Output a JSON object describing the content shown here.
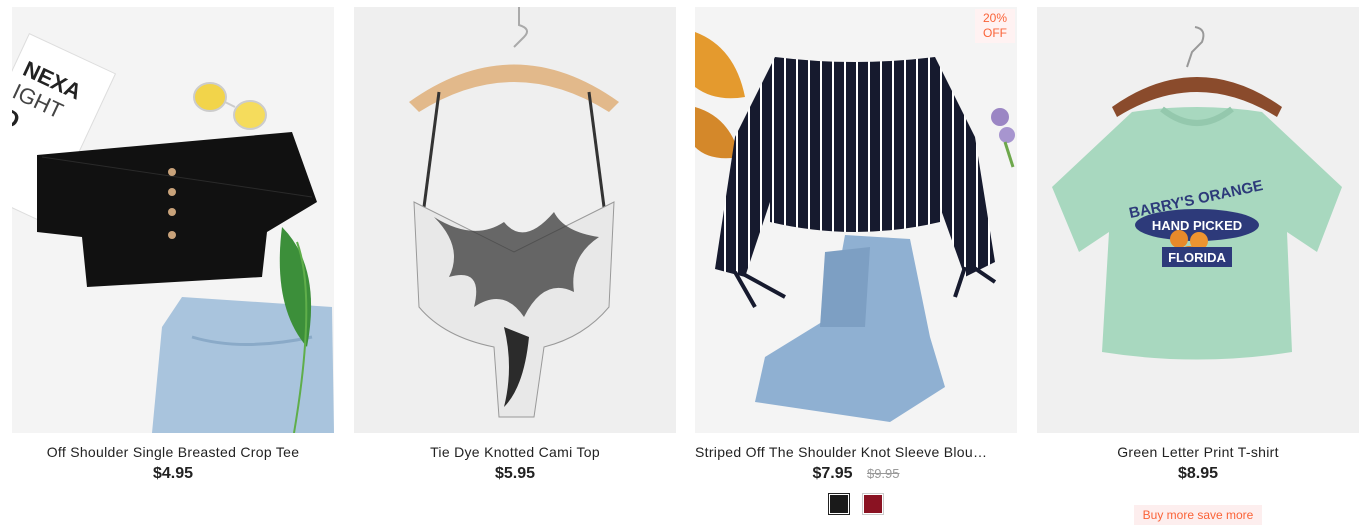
{
  "products": [
    {
      "title": "Off Shoulder Single Breasted Crop Tee",
      "price": "$4.95"
    },
    {
      "title": "Tie Dye Knotted Cami Top",
      "price": "$5.95"
    },
    {
      "title": "Striped Off The Shoulder Knot Sleeve Blou…",
      "price": "$7.95",
      "original_price": "$9.95",
      "badge_line1": "20%",
      "badge_line2": "OFF",
      "swatch_colors": [
        "#1a1a1a",
        "#8a1222"
      ]
    },
    {
      "title": "Green Letter Print T-shirt",
      "price": "$8.95",
      "promo": "Buy more save more",
      "print_line1": "BARRY'S ORANGE",
      "print_line2": "HAND PICKED",
      "print_line3": "FLORIDA"
    }
  ],
  "decor": {
    "box_text1": "NEXA",
    "box_text2": "IGHT",
    "box_text3": "D",
    "box_text4": "D"
  },
  "colors": {
    "accent": "#fa6338",
    "badge_bg": "#fff2f2",
    "mint": "#a8d8bf"
  }
}
